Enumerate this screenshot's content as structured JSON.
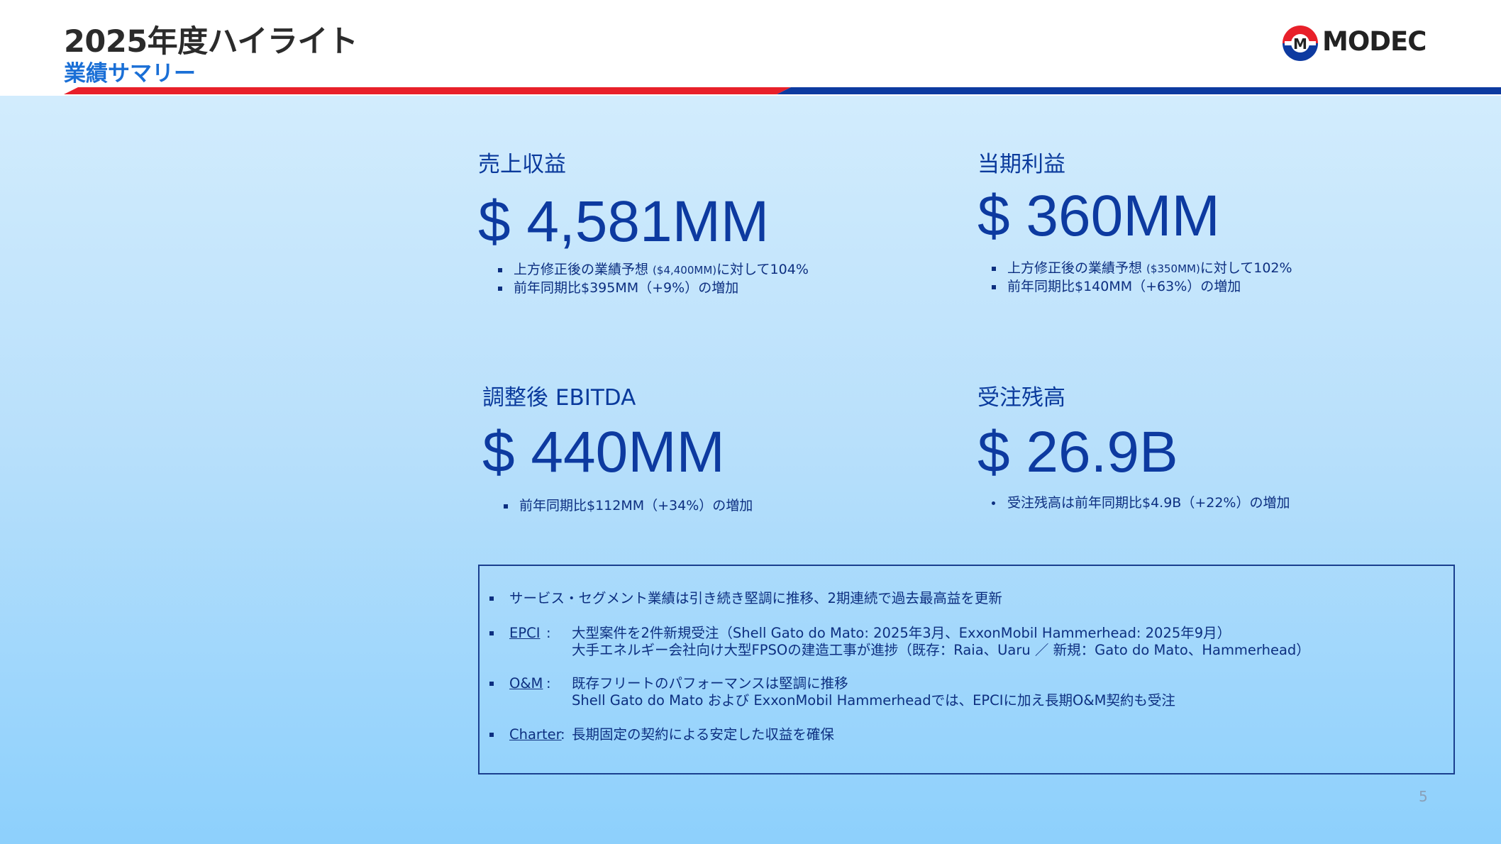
{
  "header": {
    "title": "2025年度ハイライト",
    "subtitle": "業績サマリー",
    "logo_text": "MODEC",
    "logo_mark": "M",
    "accent_red": "#e8202a",
    "accent_blue": "#0d3aa0"
  },
  "kpis": {
    "revenue": {
      "label": "売上収益",
      "value": "$ 4,581MM",
      "notes": [
        {
          "pre": "上方修正後の業績予想 ",
          "small": "($4,400MM)",
          "post": "に対して104%"
        },
        {
          "pre": "前年同期比$395MM（+9%）の増加"
        }
      ]
    },
    "net_income": {
      "label": "当期利益",
      "value": "$ 360MM",
      "notes": [
        {
          "pre": "上方修正後の業績予想 ",
          "small": "($350MM)",
          "post": "に対して102%"
        },
        {
          "pre": "前年同期比$140MM（+63%）の増加"
        }
      ]
    },
    "ebitda": {
      "label": "調整後 EBITDA",
      "value": "$ 440MM",
      "notes": [
        {
          "pre": "前年同期比$112MM（+34%）の増加"
        }
      ]
    },
    "backlog": {
      "label": "受注残高",
      "value": "$ 26.9B",
      "notes": [
        {
          "pre": "受注残高は前年同期比$4.9B（+22%）の増加"
        }
      ]
    }
  },
  "summary": {
    "services": "サービス・セグメント業績は引き続き堅調に推移、2期連続で過去最高益を更新",
    "epci": {
      "label": "EPCI",
      "line1": "大型案件を2件新規受注（Shell Gato do Mato: 2025年3月、ExxonMobil Hammerhead: 2025年9月）",
      "line2": "大手エネルギー会社向け大型FPSOの建造工事が進捗（既存：Raia、Uaru ／ 新規：Gato do Mato、Hammerhead）"
    },
    "om": {
      "label": "O&M",
      "line1": "既存フリートのパフォーマンスは堅調に推移",
      "line2": "Shell Gato do Mato および ExxonMobil Hammerheadでは、EPCIに加え長期O&M契約も受注"
    },
    "charter": {
      "label": "Charter",
      "text": "長期固定の契約による安定した収益を確保"
    }
  },
  "page_number": "5"
}
